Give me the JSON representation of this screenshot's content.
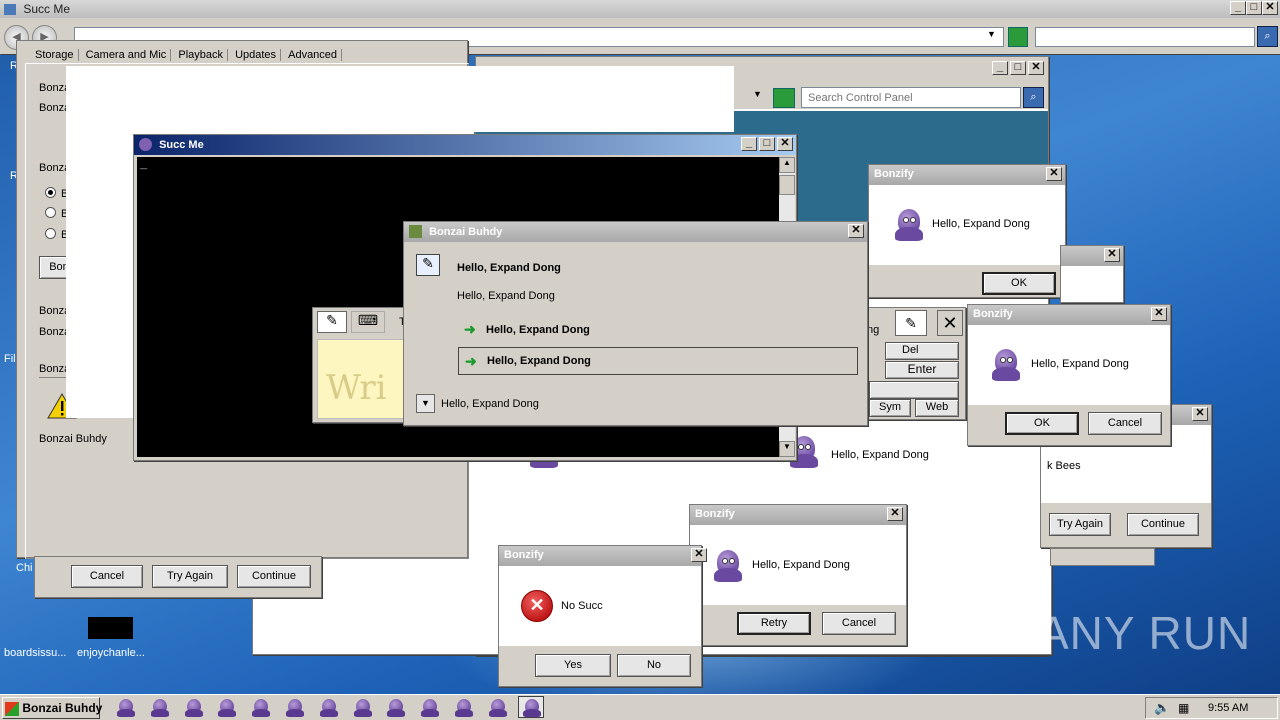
{
  "browser": {
    "title": "Succ Me",
    "address": "",
    "search": ""
  },
  "control_panel": {
    "search_placeholder": "Search Control Panel"
  },
  "settings": {
    "tabs": [
      "Storage",
      "Camera and Mic",
      "Playback",
      "Updates",
      "Advanced"
    ],
    "labels": [
      "Bonza",
      "Bonza",
      "Bonza",
      "Bonza",
      "Bonza",
      "Bonza"
    ],
    "radio_labels": [
      "B",
      "B",
      "B"
    ],
    "button_label": "Bon",
    "footer_text": "Bonzai Buhdy"
  },
  "succ_console": {
    "title": "Succ Me",
    "cursor": "_"
  },
  "dialog_main": {
    "title": "Bonzai Buhdy",
    "heading": "Hello, Expand Dong",
    "subtext": "Hello, Expand Dong",
    "options": [
      "Hello, Expand Dong",
      "Hello, Expand Dong"
    ],
    "details": "Hello, Expand Dong"
  },
  "tip": {
    "tab_label": "T",
    "write_text": "Wri"
  },
  "keyboard": {
    "tab_frag": "ng",
    "keys": [
      "Del",
      "Enter",
      "Sym",
      "Web"
    ]
  },
  "bonzify1": {
    "title": "Bonzify",
    "message": "Hello, Expand Dong",
    "ok": "OK"
  },
  "bonzify2": {
    "title": "Bonzify",
    "message": "Hello, Expand Dong",
    "ok": "OK",
    "cancel": "Cancel"
  },
  "bonzify3": {
    "title": "Bonzify",
    "message": "Hello, Expand Dong",
    "retry": "Retry",
    "cancel": "Cancel"
  },
  "bonzify4": {
    "title": "Bonzify",
    "message": "No Succ",
    "yes": "Yes",
    "no": "No"
  },
  "rear_dialog": {
    "message": "Hello, Expand Dong"
  },
  "bees_dialog": {
    "fragment": "k Bees",
    "try_again": "Try Again",
    "continue": "Continue"
  },
  "lower_left_dialog": {
    "cancel": "Cancel",
    "try_again": "Try Again",
    "continue": "Continue"
  },
  "desktop_icons": [
    "boardsissu...",
    "enjoychanle..."
  ],
  "desktop_frags": [
    "R",
    "R",
    "File",
    "Chi"
  ],
  "taskbar": {
    "start_label": "Bonzai Buhdy",
    "clock": "9:55 AM",
    "task_count": 13
  },
  "watermark": "ANY RUN",
  "colors": {
    "accent_caption": "#0a246a",
    "error_red": "#d42020",
    "bonzi_purple": "#7050a8"
  }
}
